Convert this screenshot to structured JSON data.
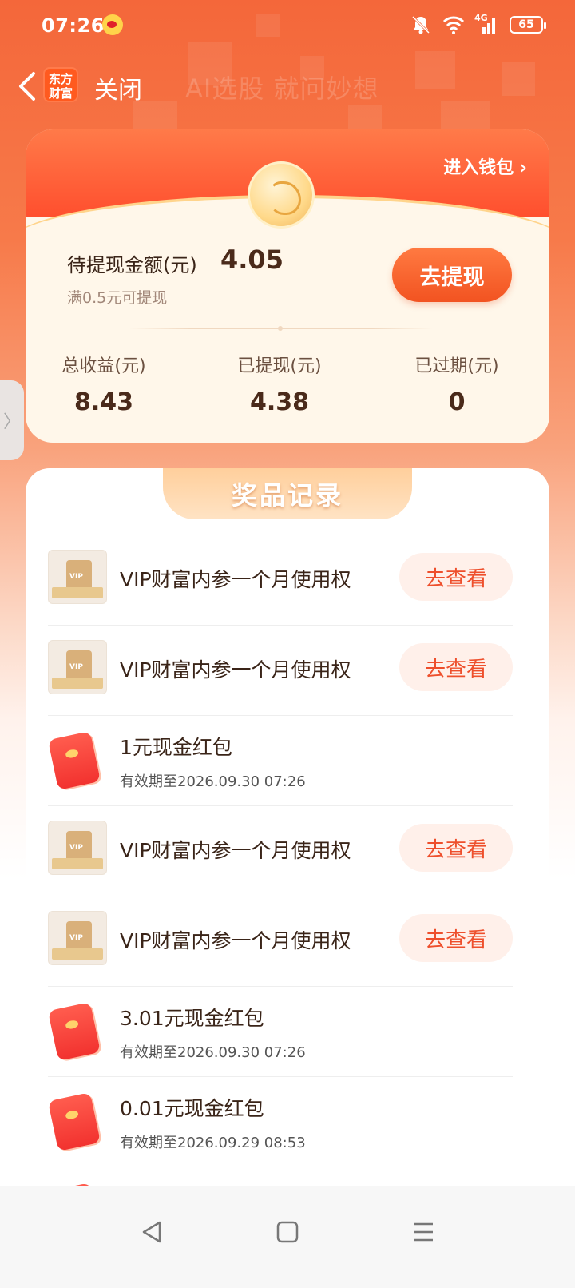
{
  "status_bar": {
    "time": "07:26",
    "network": "4G",
    "battery": "65"
  },
  "header": {
    "logo_text": "东方财富",
    "close_label": "关闭",
    "watermark": "AI选股 就问妙想"
  },
  "wallet": {
    "enter_wallet": "进入钱包",
    "pending_label": "待提现金额(元)",
    "pending_value": "4.05",
    "pending_note": "满0.5元可提现",
    "withdraw_button": "去提现",
    "stats": [
      {
        "label": "总收益(元)",
        "value": "8.43"
      },
      {
        "label": "已提现(元)",
        "value": "4.38"
      },
      {
        "label": "已过期(元)",
        "value": "0"
      }
    ]
  },
  "side_tab": {
    "glyph": "〉"
  },
  "prizes": {
    "title": "奖品记录",
    "items": [
      {
        "kind": "vip",
        "title": "VIP财富内参一个月使用权",
        "button": "去查看"
      },
      {
        "kind": "vip",
        "title": "VIP财富内参一个月使用权",
        "button": "去查看"
      },
      {
        "kind": "red",
        "title": "1元现金红包",
        "sub": "有效期至2026.09.30 07:26"
      },
      {
        "kind": "vip",
        "title": "VIP财富内参一个月使用权",
        "button": "去查看"
      },
      {
        "kind": "vip",
        "title": "VIP财富内参一个月使用权",
        "button": "去查看"
      },
      {
        "kind": "red",
        "title": "3.01元现金红包",
        "sub": "有效期至2026.09.30 07:26"
      },
      {
        "kind": "red",
        "title": "0.01元现金红包",
        "sub": "有效期至2026.09.29 08:53"
      }
    ]
  },
  "colors": {
    "brand_orange": "#f4673a",
    "button_orange": "#f25321",
    "view_button_text": "#ee4f2c"
  }
}
